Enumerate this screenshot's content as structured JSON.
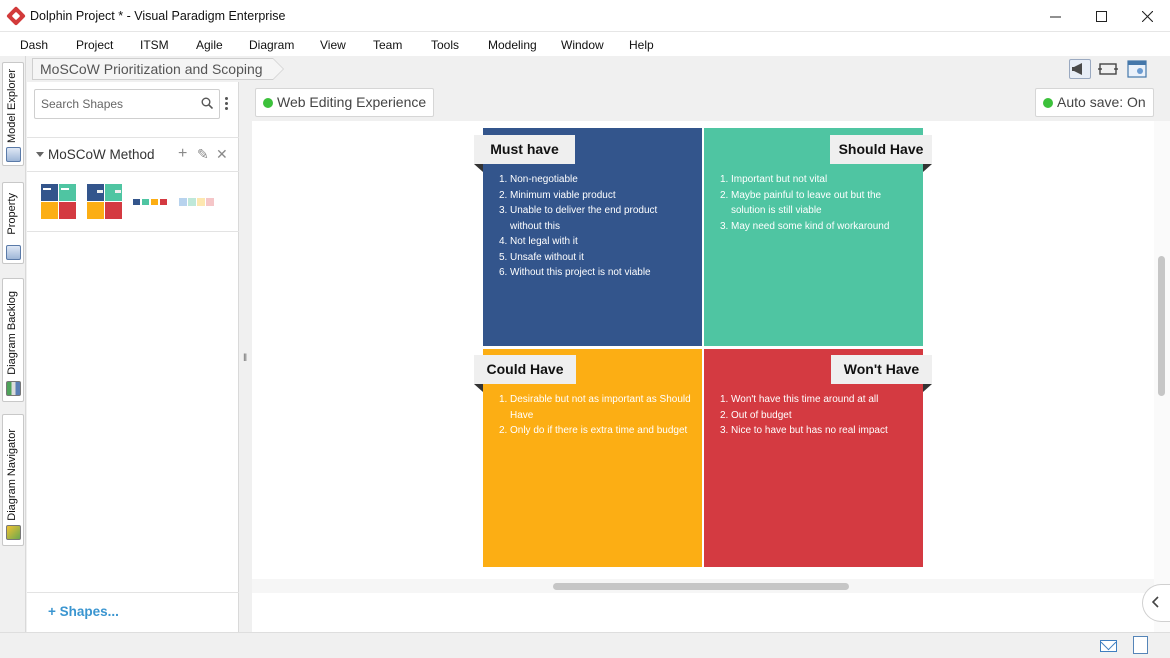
{
  "window": {
    "title": "Dolphin Project * - Visual Paradigm Enterprise",
    "controls": [
      "—",
      "☐",
      "✕"
    ]
  },
  "menu": [
    "Dash",
    "Project",
    "ITSM",
    "Agile",
    "Diagram",
    "View",
    "Team",
    "Tools",
    "Modeling",
    "Window",
    "Help"
  ],
  "left_tabs": [
    "Model Explorer",
    "Property",
    "Diagram Backlog",
    "Diagram Navigator"
  ],
  "breadcrumb": "MoSCoW Prioritization and Scoping",
  "shapes_panel": {
    "search_placeholder": "Search Shapes",
    "group_title": "MoSCoW Method",
    "shapes_link": "Shapes..."
  },
  "diagram": {
    "chip_title": "Web Editing Experience",
    "autosave": "Auto save: On",
    "quadrants": {
      "must": {
        "label": "Must have",
        "color": "#33558c",
        "items": [
          "Non-negotiable",
          "Minimum viable product",
          "Unable to deliver the end product without this",
          "Not legal with it",
          "Unsafe without it",
          "Without this project is not viable"
        ]
      },
      "should": {
        "label": "Should Have",
        "color": "#4fc5a2",
        "items": [
          "Important but not vital",
          "Maybe painful to leave out but the solution is still viable",
          "May need some kind of workaround"
        ]
      },
      "could": {
        "label": "Could Have",
        "color": "#fcae14",
        "items": [
          "Desirable but not as important as Should Have",
          "Only do if there is extra time and budget"
        ]
      },
      "wont": {
        "label": "Won't Have",
        "color": "#d43a41",
        "items": [
          "Won't have this time around at all",
          "Out of budget",
          "Nice to have but has no real impact"
        ]
      }
    }
  }
}
